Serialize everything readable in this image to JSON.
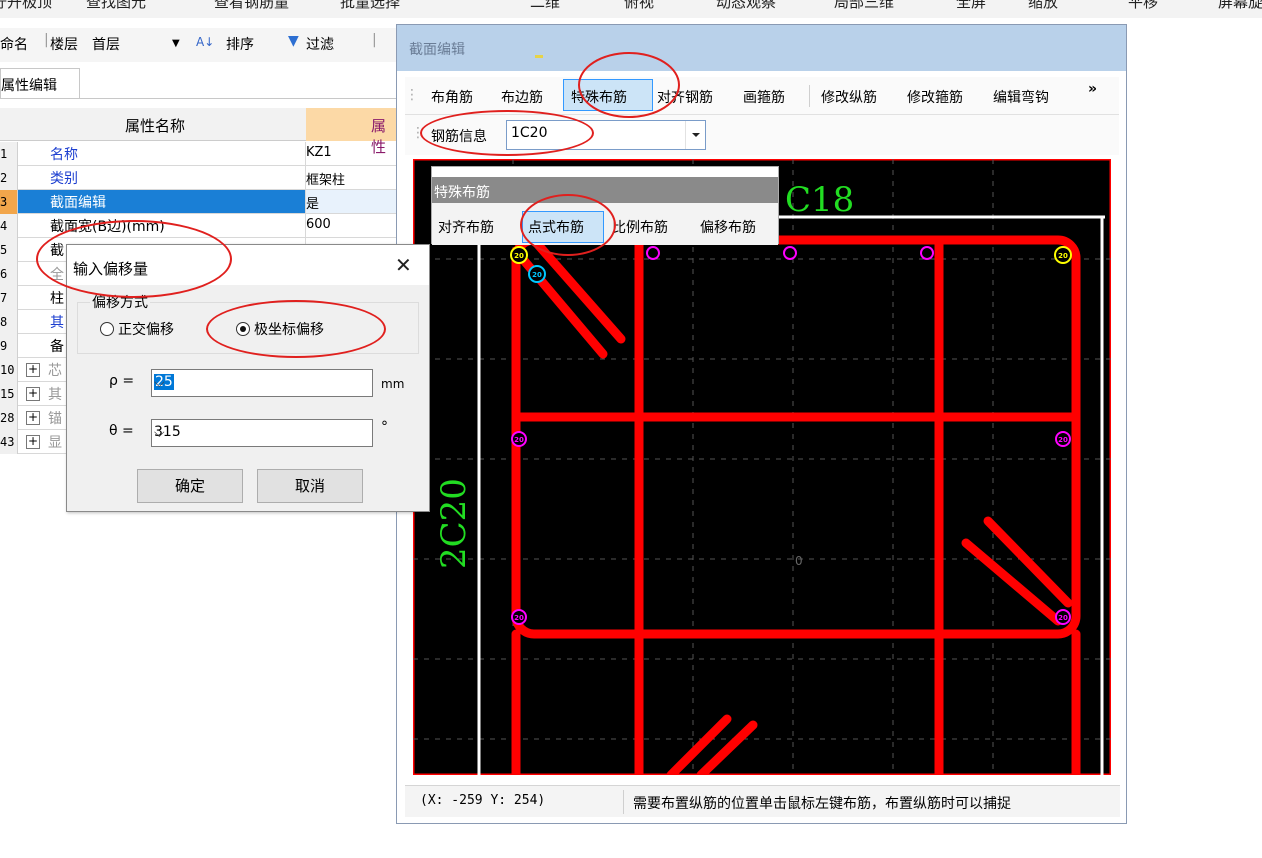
{
  "topbar": {
    "items": [
      "柠开极顶",
      "查找图元",
      "查看钢筋量",
      "批量选择",
      "二维",
      "俯视",
      "动态观察",
      "局部三维",
      "全屏",
      "缩放",
      "平移",
      "屏幕旋"
    ]
  },
  "toolbar2": {
    "rename": "命名",
    "floor_label": "楼层",
    "floor_value": "首层",
    "sort": "排序",
    "filter": "过滤"
  },
  "property_panel": {
    "tab": "属性编辑",
    "col_name": "属性名称",
    "col_value": "属性",
    "rows": [
      {
        "num": "1",
        "name": "名称",
        "value": "KZ1"
      },
      {
        "num": "2",
        "name": "类别",
        "value": "框架柱"
      },
      {
        "num": "3",
        "name": "截面编辑",
        "value": "是"
      },
      {
        "num": "4",
        "name": "截面宽(B边)(mm)",
        "value": "600"
      },
      {
        "num": "5",
        "name": "截",
        "value": ""
      },
      {
        "num": "6",
        "name": "全",
        "value": ""
      },
      {
        "num": "7",
        "name": "柱",
        "value": ""
      },
      {
        "num": "8",
        "name": "其",
        "value": ""
      },
      {
        "num": "9",
        "name": "备",
        "value": ""
      },
      {
        "num": "10",
        "name": "芯",
        "value": ""
      },
      {
        "num": "15",
        "name": "其",
        "value": ""
      },
      {
        "num": "28",
        "name": "锚",
        "value": ""
      },
      {
        "num": "43",
        "name": "显",
        "value": ""
      }
    ]
  },
  "section_editor": {
    "title": "截面编辑",
    "toolbar": [
      "布角筋",
      "布边筋",
      "特殊布筋",
      "对齐钢筋",
      "画箍筋",
      "修改纵筋",
      "修改箍筋",
      "编辑弯钩"
    ],
    "more": "»",
    "rebar_info_label": "钢筋信息",
    "rebar_info_value": "1C20",
    "top_label": "C18",
    "side_label": "2C20",
    "center_mark": "0",
    "corner_bar_label": "20",
    "status_coord": "(X: -259 Y: 254)",
    "status_msg": "需要布置纵筋的位置单击鼠标左键布筋，布置纵筋时可以捕捉"
  },
  "special_layout": {
    "title": "特殊布筋",
    "buttons": [
      "对齐布筋",
      "点式布筋",
      "比例布筋",
      "偏移布筋"
    ]
  },
  "offset_dialog": {
    "title": "输入偏移量",
    "close": "✕",
    "group_label": "偏移方式",
    "option_ortho": "正交偏移",
    "option_polar": "极坐标偏移",
    "rho_label": "ρ =",
    "rho_value": "25",
    "rho_unit": "mm",
    "theta_label": "θ =",
    "theta_value": "315",
    "theta_unit": "°",
    "ok": "确定",
    "cancel": "取消"
  },
  "colors": {
    "rebar": "#ff0000",
    "canvas_bg": "#000000",
    "label_green": "#22dd22",
    "bar_magenta": "#ff00ff",
    "bar_yellow": "#ffff00",
    "bar_cyan": "#00c8ff",
    "annotation_red": "#e0201e"
  }
}
